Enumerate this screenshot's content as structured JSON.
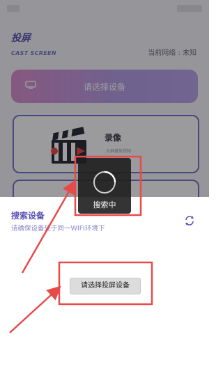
{
  "header": {
    "title": "投屏",
    "subtitle": "CAST SCREEN",
    "network_status": "当前网络 : 未知"
  },
  "main": {
    "select_device_label": "请选择设备",
    "record_card": {
      "title": "录像",
      "subtitle": "大屏播放视频"
    }
  },
  "sheet": {
    "title": "搜索设备",
    "hint": "请确保设备处于同一WIFI环境下",
    "choose_button": "请选择投屏设备"
  },
  "toast": {
    "label": "搜索中"
  },
  "colors": {
    "accent": "#5a54b4",
    "annotation": "#e84a4a",
    "gradient_start": "#d88fcf",
    "gradient_end": "#b9a3e8"
  },
  "icons": [
    "tv-icon",
    "clapperboard-icon",
    "refresh-icon",
    "spinner-icon"
  ]
}
